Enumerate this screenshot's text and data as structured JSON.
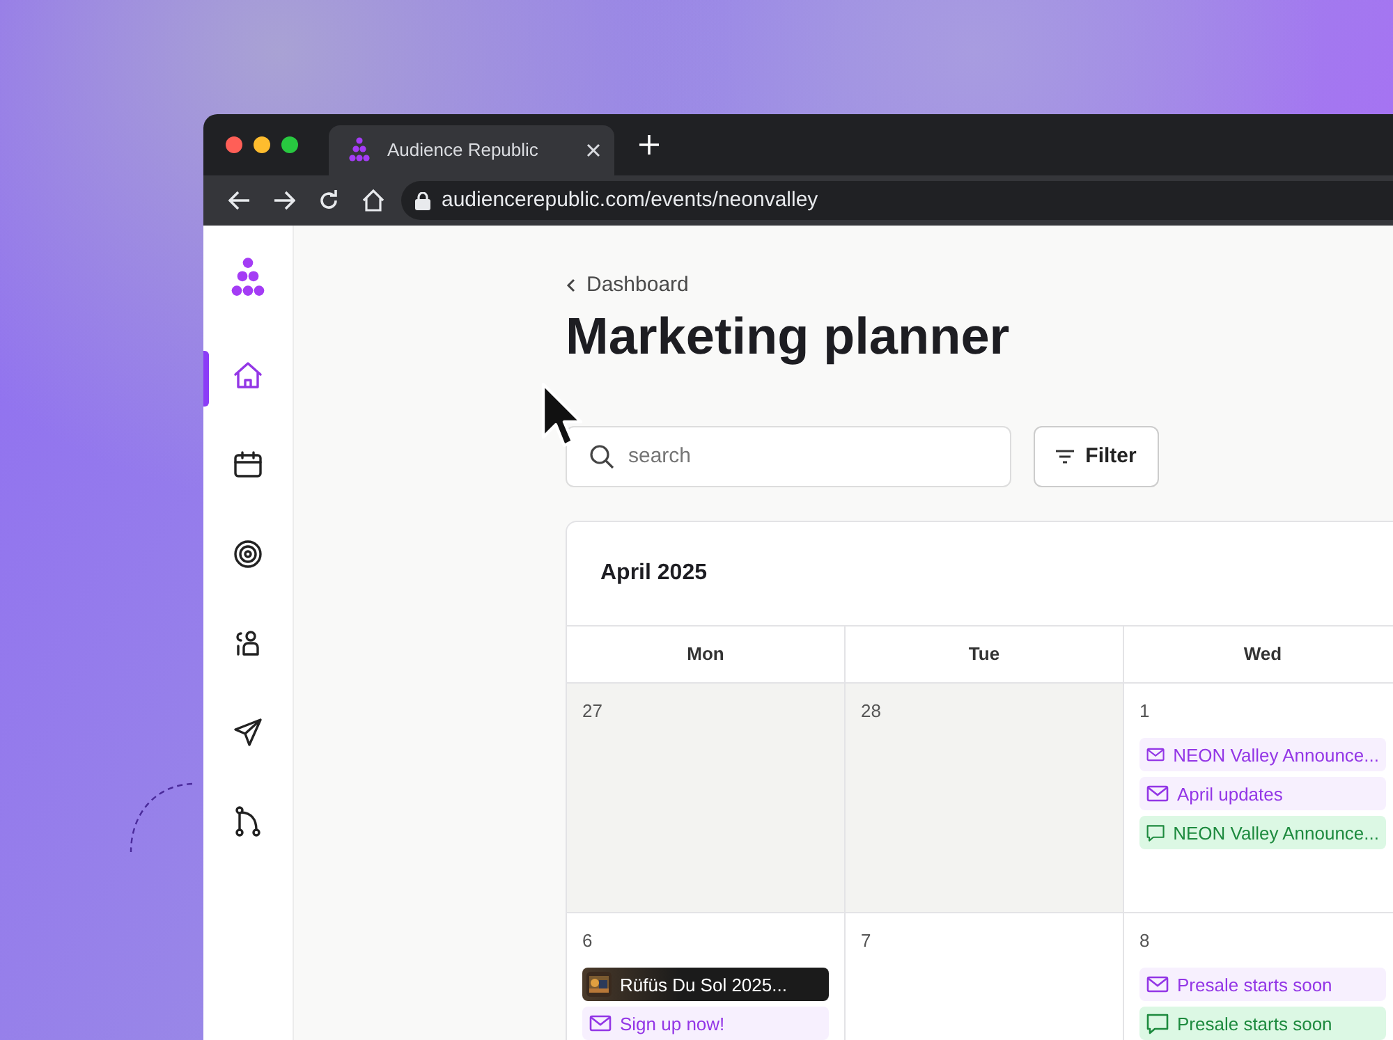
{
  "browser": {
    "tab_title": "Audience Republic",
    "url": "audiencerepublic.com/events/neonvalley"
  },
  "sidebar": {
    "items": [
      {
        "kind": "home",
        "selected": true
      },
      {
        "kind": "calendar",
        "selected": false
      },
      {
        "kind": "target",
        "selected": false
      },
      {
        "kind": "people",
        "selected": false
      },
      {
        "kind": "send",
        "selected": false
      },
      {
        "kind": "flow",
        "selected": false
      }
    ]
  },
  "breadcrumb": "Dashboard",
  "title": "Marketing planner",
  "search": {
    "placeholder": "search"
  },
  "filter_button": "Filter",
  "calendar": {
    "month": "April 2025",
    "weekdays": [
      "Mon",
      "Tue",
      "Wed"
    ],
    "weeks": [
      [
        {
          "day": "27",
          "outside": true
        },
        {
          "day": "28",
          "outside": true
        },
        {
          "day": "1",
          "outside": false,
          "events": [
            {
              "kind": "email",
              "label": "NEON Valley Announce..."
            },
            {
              "kind": "email",
              "label": "April updates"
            },
            {
              "kind": "sms",
              "label": "NEON Valley Announce..."
            }
          ]
        }
      ],
      [
        {
          "day": "6",
          "outside": false,
          "events": [
            {
              "kind": "event",
              "label": "Rüfüs Du Sol 2025..."
            },
            {
              "kind": "email",
              "label": "Sign up now!"
            }
          ]
        },
        {
          "day": "7",
          "outside": false
        },
        {
          "day": "8",
          "outside": false,
          "events": [
            {
              "kind": "email",
              "label": "Presale starts soon"
            },
            {
              "kind": "sms",
              "label": "Presale starts soon"
            }
          ]
        }
      ]
    ]
  }
}
